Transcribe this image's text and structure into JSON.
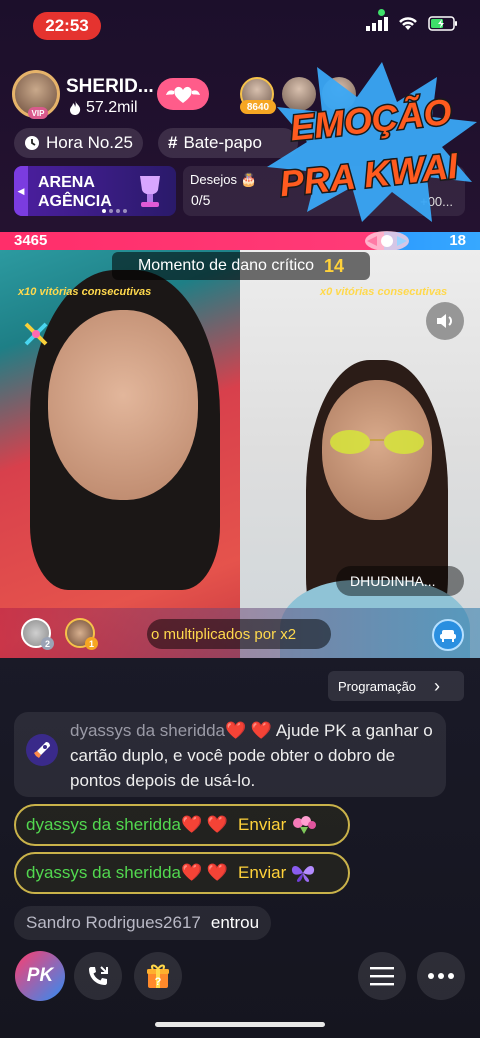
{
  "status_bar": {
    "time": "22:53"
  },
  "header": {
    "host_name": "SHERID...",
    "host_likes": "57.2mil",
    "host_badge": "VIP",
    "viewer_badge_count": "8640"
  },
  "chips": {
    "hour": "Hora No.25",
    "chat": "Bate-papo"
  },
  "arena": {
    "line1": "ARENA",
    "line2": "AGÊNCIA"
  },
  "wishes": {
    "label": "Desejos",
    "count": "0/5",
    "extra": "+00..."
  },
  "overlay_art": {
    "line1": "EMOÇÃO",
    "line2": "PRA KWAI"
  },
  "pk": {
    "left_score": "3465",
    "right_score": "18",
    "critical_label": "Momento de dano crítico",
    "critical_count": "14",
    "left_streak": "x10 vitórias consecutivas",
    "right_streak": "x0 vitórias consecutivas",
    "opponent_name": "DHUDINHA...",
    "multiplier_text": "o multiplicados por x2",
    "left_avatar_badges": [
      "2",
      "1"
    ]
  },
  "programacao": "Programação",
  "system_message": {
    "name": "dyassys da sheridda❤️ ❤️",
    "text": "Ajude PK a ganhar o cartão duplo, e você pode obter o dobro de pontos depois de usá-lo."
  },
  "gift_messages": [
    {
      "name": "dyassys da sheridda❤️ ❤️",
      "action": "Enviar",
      "gift_icon": "bouquet-icon"
    },
    {
      "name": "dyassys da sheridda❤️ ❤️",
      "action": "Enviar",
      "gift_icon": "butterfly-icon"
    }
  ],
  "joined": {
    "name": "Sandro Rodrigues2617",
    "text": "entrou"
  },
  "bottom_bar": {
    "pk_label": "PK"
  },
  "colors": {
    "pk_red": "#ff2e6a",
    "pk_blue": "#2c9bff",
    "gift_name_green": "#52d84f",
    "gold": "#ffd23a"
  }
}
